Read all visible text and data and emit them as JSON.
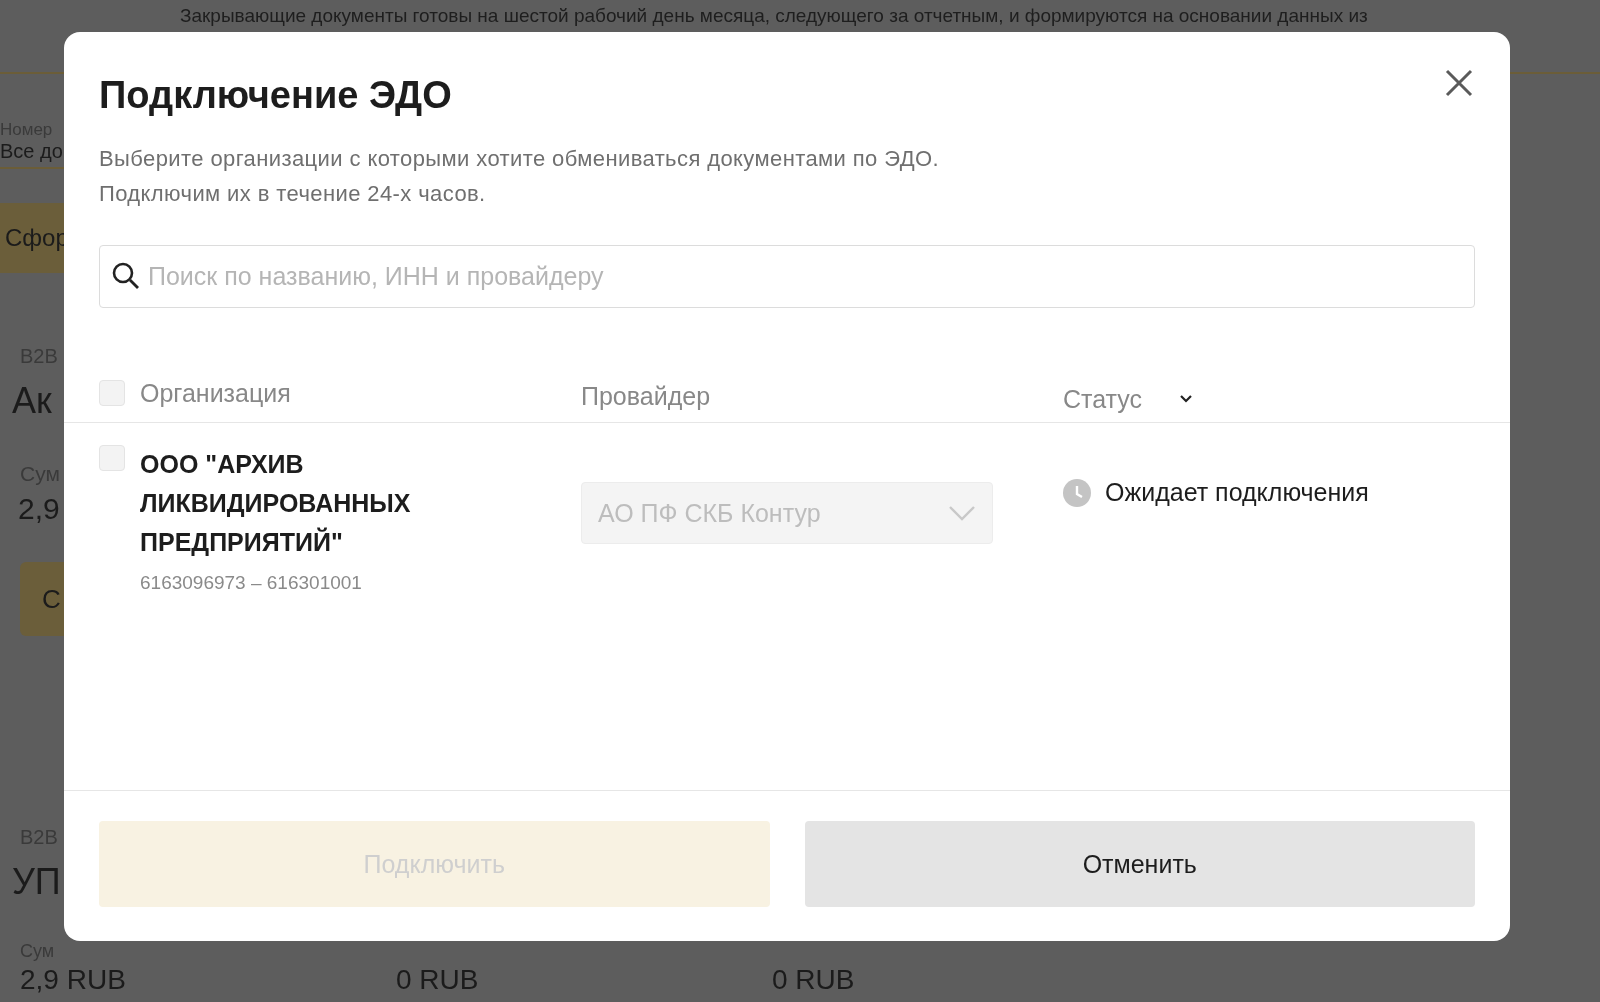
{
  "background_page": {
    "notice": "Закрывающие документы готовы на шестой рабочий день месяца, следующего за отчетным, и формируются на основании данных из",
    "filter": {
      "label": "Номер",
      "value": "Все до"
    },
    "generate_button": "Сфор",
    "cards": [
      {
        "tag": "B2B",
        "title": "Ак",
        "sum_label": "Сум",
        "sum": "2,9",
        "button": "С"
      },
      {
        "tag": "B2B",
        "title": "УП",
        "sum_label": "Сум"
      }
    ],
    "amounts": [
      "2,9 RUB",
      "0 RUB",
      "0 RUB"
    ]
  },
  "modal": {
    "title": "Подключение ЭДО",
    "description": [
      "Выберите организации с которыми хотите обмениваться документами по ЭДО.",
      "Подключим их в течение 24-х часов."
    ],
    "search": {
      "placeholder": "Поиск по названию, ИНН и провайдеру"
    },
    "select_all": {
      "checked": false
    },
    "columns": [
      {
        "label": "Организация",
        "kind": "plain"
      },
      {
        "label": "Провайдер",
        "kind": "plain"
      },
      {
        "label": "Статус",
        "kind": "sortable"
      }
    ],
    "rows": [
      {
        "checked": false,
        "name": "ООО \"АРХИВ ЛИКВИДИРОВАННЫХ ПРЕДПРИЯТИЙ\"",
        "ids": "6163096973 – 616301001",
        "provider": {
          "value": "АО ПФ СКБ Контур",
          "disabled": true
        },
        "status": {
          "label": "Ожидает подключения",
          "kind": "pending"
        }
      }
    ],
    "buttons": [
      {
        "label": "Подключить",
        "kind": "primary",
        "disabled": true
      },
      {
        "label": "Отменить",
        "kind": "secondary",
        "disabled": false
      }
    ]
  }
}
